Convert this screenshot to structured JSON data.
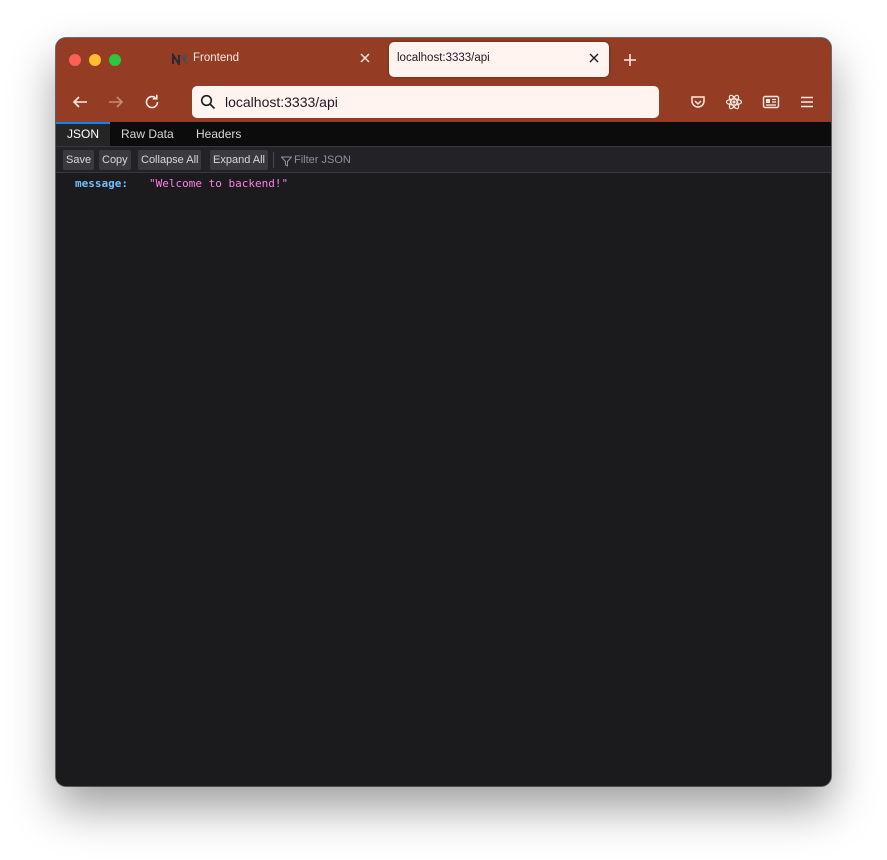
{
  "tabs": [
    {
      "title": "Frontend",
      "favicon": "nx-logo-icon",
      "active": false
    },
    {
      "title": "localhost:3333/api",
      "active": true
    }
  ],
  "toolbar": {
    "url": "localhost:3333/api",
    "icons": [
      "back-arrow-icon",
      "forward-arrow-icon",
      "reload-icon",
      "pocket-icon",
      "react-devtools-icon",
      "reader-view-icon",
      "menu-icon"
    ]
  },
  "json_viewer": {
    "tabs": [
      "JSON",
      "Raw Data",
      "Headers"
    ],
    "buttons": {
      "save": "Save",
      "copy": "Copy",
      "collapse_all": "Collapse All",
      "expand_all": "Expand All"
    },
    "filter_placeholder": "Filter JSON",
    "rows": [
      {
        "key": "message:",
        "value": "\"Welcome to backend!\""
      }
    ]
  },
  "colors": {
    "chrome": "#943d24",
    "active_tab": "#fff4f0",
    "json_key": "#75bfff",
    "json_string": "#ff7de9",
    "accent": "#0a84ff"
  }
}
